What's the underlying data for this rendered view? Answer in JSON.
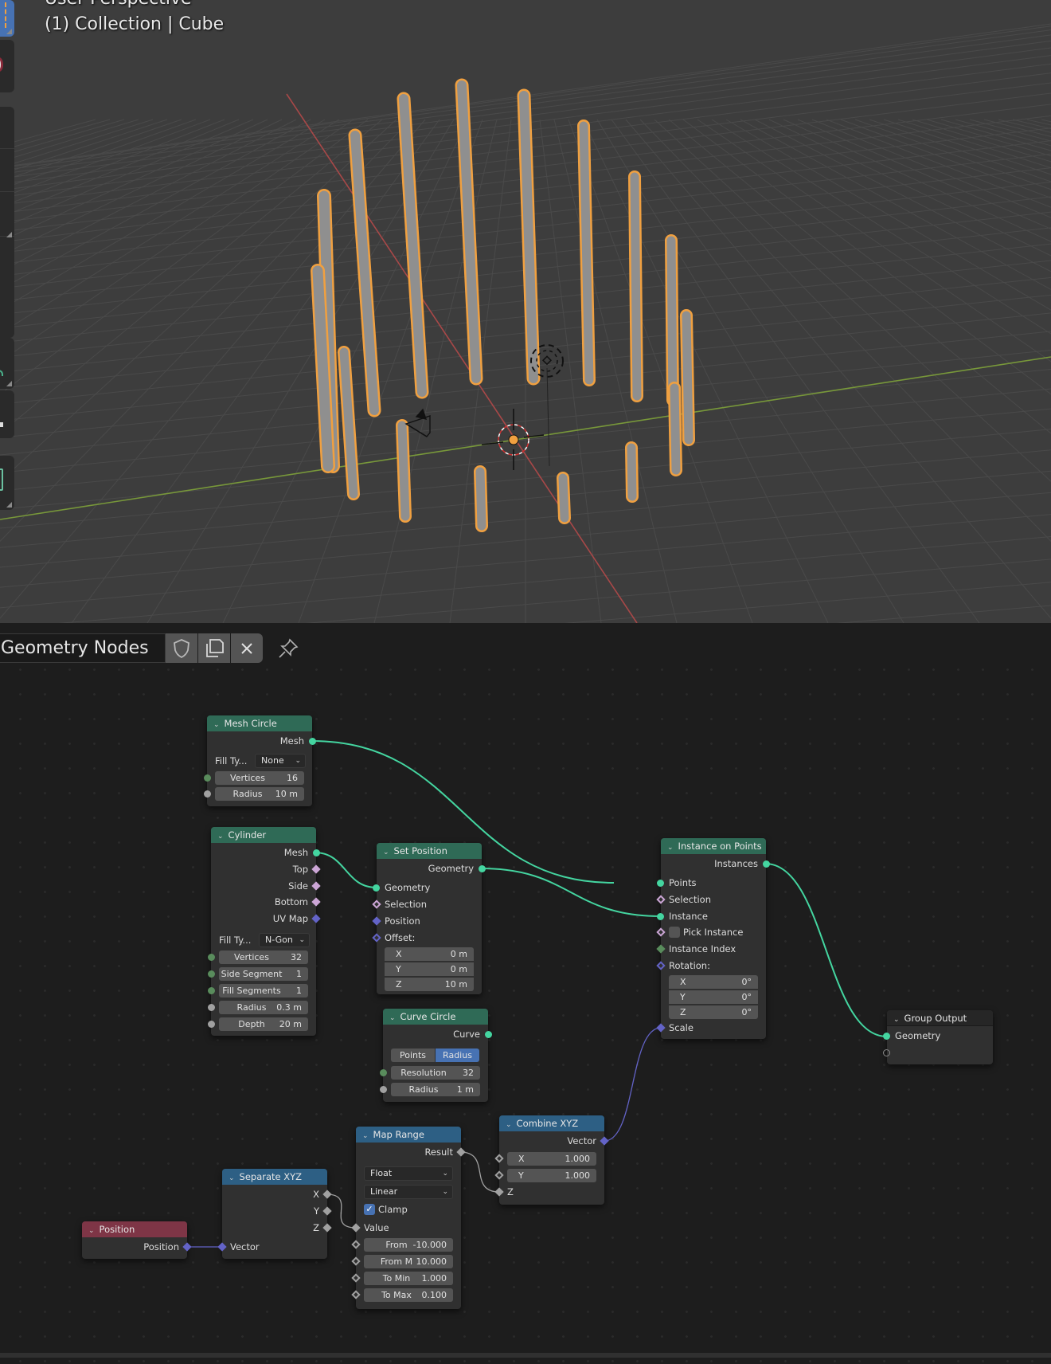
{
  "viewport": {
    "view_label": "User Perspective",
    "object_label": "(1) Collection | Cube",
    "colors": {
      "background": "#3d3d3d",
      "grid": "#4a4a4a",
      "x_axis": "#b34a4a",
      "y_axis": "#7a9a3a",
      "selection_outline": "#f0a040",
      "object": "#8f8f8f"
    }
  },
  "node_editor": {
    "header": {
      "node_tree_name": "Geometry Nodes",
      "buttons": [
        "fake-user",
        "duplicate",
        "unlink"
      ],
      "pin": "pin"
    },
    "nodes": {
      "mesh_circle": {
        "title": "Mesh Circle",
        "outputs": [
          "Mesh"
        ],
        "fill_type_label": "Fill Ty...",
        "fill_type_value": "None",
        "fields": [
          {
            "label": "Vertices",
            "value": "16"
          },
          {
            "label": "Radius",
            "value": "10 m"
          }
        ]
      },
      "cylinder": {
        "title": "Cylinder",
        "outputs": [
          "Mesh",
          "Top",
          "Side",
          "Bottom",
          "UV Map"
        ],
        "fill_type_label": "Fill Ty...",
        "fill_type_value": "N-Gon",
        "fields": [
          {
            "label": "Vertices",
            "value": "32"
          },
          {
            "label": "Side Segment",
            "value": "1"
          },
          {
            "label": "Fill Segments",
            "value": "1"
          },
          {
            "label": "Radius",
            "value": "0.3 m"
          },
          {
            "label": "Depth",
            "value": "20 m"
          }
        ]
      },
      "set_position": {
        "title": "Set Position",
        "outputs": [
          "Geometry"
        ],
        "inputs": [
          "Geometry",
          "Selection",
          "Position",
          "Offset:"
        ],
        "offset": [
          {
            "label": "X",
            "value": "0 m"
          },
          {
            "label": "Y",
            "value": "0 m"
          },
          {
            "label": "Z",
            "value": "10 m"
          }
        ]
      },
      "instance_on_points": {
        "title": "Instance on Points",
        "outputs": [
          "Instances"
        ],
        "inputs": [
          "Points",
          "Selection",
          "Instance",
          "Pick Instance",
          "Instance Index",
          "Rotation:",
          "Scale"
        ],
        "pick_instance_checked": false,
        "rotation": [
          {
            "label": "X",
            "value": "0°"
          },
          {
            "label": "Y",
            "value": "0°"
          },
          {
            "label": "Z",
            "value": "0°"
          }
        ]
      },
      "curve_circle": {
        "title": "Curve Circle",
        "outputs": [
          "Curve"
        ],
        "mode_options": [
          "Points",
          "Radius"
        ],
        "mode_selected": "Radius",
        "fields": [
          {
            "label": "Resolution",
            "value": "32"
          },
          {
            "label": "Radius",
            "value": "1 m"
          }
        ]
      },
      "group_output": {
        "title": "Group Output",
        "inputs": [
          "Geometry"
        ]
      },
      "map_range": {
        "title": "Map Range",
        "outputs": [
          "Result"
        ],
        "data_type": "Float",
        "interpolation": "Linear",
        "clamp_label": "Clamp",
        "clamp_checked": true,
        "value_label": "Value",
        "fields": [
          {
            "label": "From",
            "value": "-10.000"
          },
          {
            "label": "From M",
            "value": "10.000"
          },
          {
            "label": "To Min",
            "value": "1.000"
          },
          {
            "label": "To Max",
            "value": "0.100"
          }
        ]
      },
      "combine_xyz": {
        "title": "Combine XYZ",
        "outputs": [
          "Vector"
        ],
        "fields": [
          {
            "label": "X",
            "value": "1.000"
          },
          {
            "label": "Y",
            "value": "1.000"
          }
        ],
        "z_label": "Z"
      },
      "separate_xyz": {
        "title": "Separate XYZ",
        "outputs": [
          "X",
          "Y",
          "Z"
        ],
        "inputs": [
          "Vector"
        ]
      },
      "position": {
        "title": "Position",
        "outputs": [
          "Position"
        ]
      }
    },
    "links": [
      {
        "from": "Mesh Circle.Mesh",
        "to": "Instance on Points.Points",
        "type": "geometry"
      },
      {
        "from": "Cylinder.Mesh",
        "to": "Set Position.Geometry",
        "type": "geometry"
      },
      {
        "from": "Set Position.Geometry",
        "to": "Instance on Points.Instance",
        "type": "geometry"
      },
      {
        "from": "Instance on Points.Instances",
        "to": "Group Output.Geometry",
        "type": "geometry"
      },
      {
        "from": "Combine XYZ.Vector",
        "to": "Instance on Points.Scale",
        "type": "vector"
      },
      {
        "from": "Map Range.Result",
        "to": "Combine XYZ.Z",
        "type": "float"
      },
      {
        "from": "Separate XYZ.X",
        "to": "Map Range.Value",
        "type": "float"
      },
      {
        "from": "Position.Position",
        "to": "Separate XYZ.Vector",
        "type": "vector"
      }
    ],
    "colors": {
      "geometry_socket": "#44d5a0",
      "vector_socket": "#6363c7",
      "float_socket": "#a1a1a1",
      "int_socket": "#598c5c",
      "bool_socket": "#cca6d6",
      "geometry_header": "#2f6a56",
      "vector_header": "#2d5f84",
      "input_header": "#7e3546",
      "accent": "#4772b3"
    }
  }
}
